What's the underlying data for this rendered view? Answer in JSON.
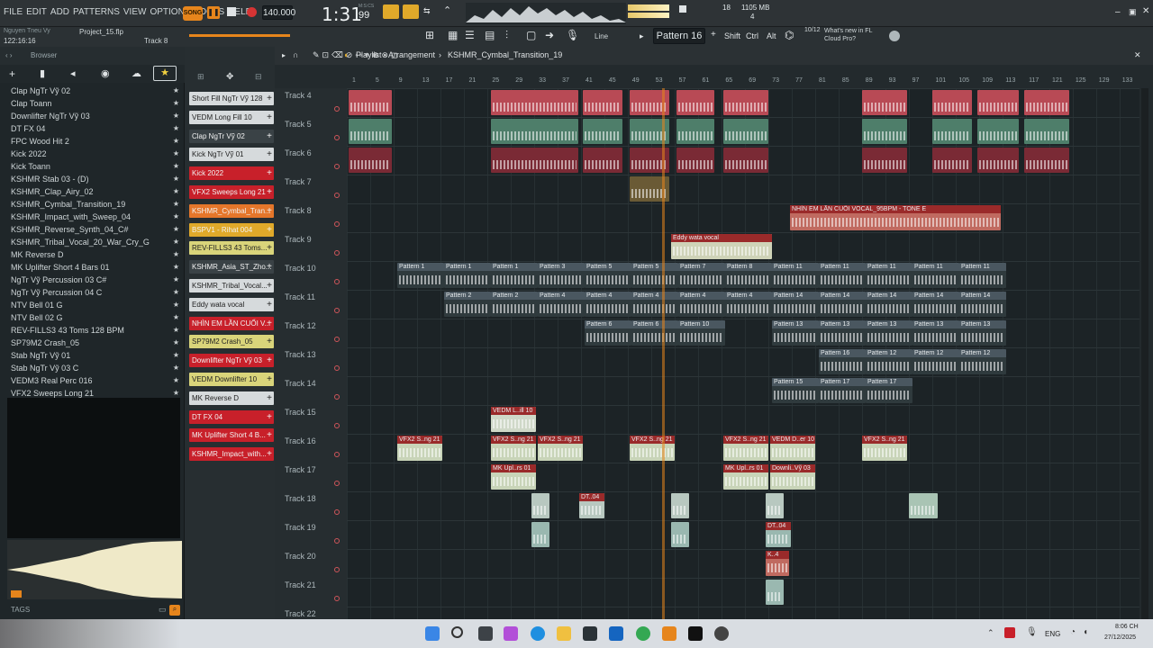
{
  "menu": [
    "FILE",
    "EDIT",
    "ADD",
    "PATTERNS",
    "VIEW",
    "OPTIONS",
    "TOOLS",
    "HELP"
  ],
  "transport": {
    "mode": "SONG",
    "tempo": "140.000",
    "time": "1:31",
    "time_sub": "99",
    "time_unit": "M:S:CS",
    "cpu": "18",
    "mem": "1105 MB",
    "poly": "4"
  },
  "project": {
    "user": "Nguyen Tneu Vy",
    "file": "Project_15.flp",
    "time": "122:16:16",
    "track": "Track 8"
  },
  "toolbar2": {
    "snap": "Line",
    "pattern": "Pattern 16",
    "shift": "Shift",
    "ctrl": "Ctrl",
    "alt": "Alt",
    "news_count": "10/12",
    "news": "What's new in FL Cloud Pro?"
  },
  "browser": {
    "title": "Browser",
    "tags": "TAGS",
    "items": [
      "Clap NgTr Vỹ 02",
      "Clap Toann",
      "Downlifter NgTr Vỹ 03",
      "DT FX 04",
      "FPC Wood Hit 2",
      "Kick 2022",
      "Kick Toann",
      "KSHMR Stab 03 - (D)",
      "KSHMR_Clap_Airy_02",
      "KSHMR_Cymbal_Transition_19",
      "KSHMR_Impact_with_Sweep_04",
      "KSHMR_Reverse_Synth_04_C#",
      "KSHMR_Tribal_Vocal_20_War_Cry_G",
      "MK Reverse D",
      "MK Uplifter Short 4 Bars 01",
      "NgTr Vỹ Percussion 03 C#",
      "NgTr Vỹ Percussion 04 C",
      "NTV Bell 01 G",
      "NTV Bell 02 G",
      "REV-FILLS3 43 Toms 128 BPM",
      "SP79M2 Crash_05",
      "Stab NgTr Vỹ 01",
      "Stab NgTr Vỹ 03 C",
      "VEDM3 Real Perc 016",
      "VFX2 Sweeps Long 21"
    ]
  },
  "channels": [
    {
      "name": "Short Fill NgTr Vỹ 128",
      "color": "#d6dadc"
    },
    {
      "name": "VEDM Long Fill 10",
      "color": "#d6dadc"
    },
    {
      "name": "Clap NgTr Vỹ 02",
      "color": "#3a4246"
    },
    {
      "name": "Kick NgTr Vỹ 01",
      "color": "#d6dadc"
    },
    {
      "name": "Kick 2022",
      "color": "#c8202a"
    },
    {
      "name": "VFX2 Sweeps Long 21",
      "color": "#c8202a"
    },
    {
      "name": "KSHMR_Cymbal_Tran...",
      "color": "#e5762a"
    },
    {
      "name": "BSPV1 - Rihat 004",
      "color": "#e0a92a"
    },
    {
      "name": "REV-FILLS3 43 Toms...",
      "color": "#d9d47a"
    },
    {
      "name": "KSHMR_Asia_ST_Zho...",
      "color": "#3a4246"
    },
    {
      "name": "KSHMR_Tribal_Vocal...",
      "color": "#d6dadc"
    },
    {
      "name": "Eddy wata vocal",
      "color": "#d6dadc"
    },
    {
      "name": "NHÌN EM LẦN CUỐI V...",
      "color": "#c8202a"
    },
    {
      "name": "SP79M2 Crash_05",
      "color": "#d9d47a"
    },
    {
      "name": "Downlifter NgTr Vỹ 03",
      "color": "#c8202a"
    },
    {
      "name": "VEDM Downlifter 10",
      "color": "#d9d47a"
    },
    {
      "name": "MK Reverse D",
      "color": "#d6dadc"
    },
    {
      "name": "DT FX 04",
      "color": "#c8202a"
    },
    {
      "name": "MK Uplifter Short 4 B...",
      "color": "#c8202a"
    },
    {
      "name": "KSHMR_Impact_with...",
      "color": "#c8202a"
    }
  ],
  "playlist": {
    "title": "Playlist - Arrangement",
    "pattern": "KSHMR_Cymbal_Transition_19",
    "ruler": [
      "1",
      "5",
      "9",
      "13",
      "17",
      "21",
      "25",
      "29",
      "33",
      "37",
      "41",
      "45",
      "49",
      "53",
      "57",
      "61",
      "65",
      "69",
      "73",
      "77",
      "81",
      "85",
      "89",
      "93",
      "97",
      "101",
      "105",
      "109",
      "113",
      "117",
      "121",
      "125",
      "129",
      "133"
    ],
    "tracks": [
      "Track 4",
      "Track 5",
      "Track 6",
      "Track 7",
      "Track 8",
      "Track 9",
      "Track 10",
      "Track 11",
      "Track 12",
      "Track 13",
      "Track 14",
      "Track 15",
      "Track 16",
      "Track 17",
      "Track 18",
      "Track 19",
      "Track 20",
      "Track 21",
      "Track 22"
    ]
  },
  "clips": {
    "vocal": "NHÌN EM LẦN CUỐI VOCAL_95BPM - TONE E",
    "eddy": "Eddy wata vocal",
    "p1": "Pattern 1",
    "p2": "Pattern 2",
    "p3": "Pattern 3",
    "p4": "Pattern 4",
    "p5": "Pattern 5",
    "p6": "Pattern 6",
    "p7": "Pattern 7",
    "p8": "Pattern 8",
    "p10": "Pattern 10",
    "p11": "Pattern 11",
    "p12": "Pattern 12",
    "p13": "Pattern 13",
    "p14": "Pattern 14",
    "p15": "Pattern 15",
    "p16": "Pattern 16",
    "p17": "Pattern 17",
    "vedm": "VEDM L..ill 10",
    "vfx": "VFX2 S..ng 21",
    "vedmd": "VEDM D..er 10",
    "mkup": "MK Upl..rs 01",
    "downli": "Downli..Vỹ 03",
    "dt": "DT..04",
    "k": "K..4"
  },
  "taskbar": {
    "lang": "ENG",
    "time": "8:06 CH",
    "date": "27/12/2025"
  }
}
